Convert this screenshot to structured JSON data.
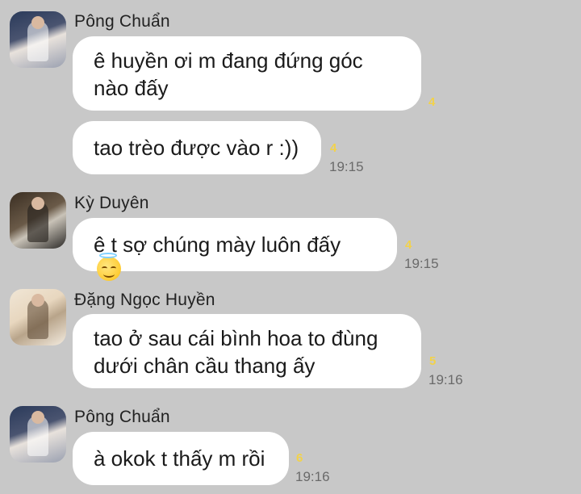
{
  "messages": [
    {
      "sender": "Pông Chuẩn",
      "avatar": "avatar-pong-chuan",
      "bubbles": [
        {
          "lines": [
            "ê huyền ơi m đang đứng góc",
            "nào đấy"
          ],
          "count": "4",
          "time": ""
        },
        {
          "lines": [
            "tao trèo được vào r :))"
          ],
          "count": "4",
          "time": "19:15"
        }
      ]
    },
    {
      "sender": "Kỳ Duyên",
      "avatar": "avatar-ky-duyen",
      "bubbles": [
        {
          "lines": [
            "ê t sợ chúng mày luôn đấy"
          ],
          "emoji": "smiling-face-with-halo-icon",
          "count": "4",
          "time": "19:15"
        }
      ]
    },
    {
      "sender": "Đặng Ngọc Huyền",
      "avatar": "avatar-dang-ngoc-huyen",
      "bubbles": [
        {
          "lines": [
            "tao ở sau cái bình hoa to đùng",
            "dưới chân cầu thang ấy"
          ],
          "count": "5",
          "time": "19:16"
        }
      ]
    },
    {
      "sender": "Pông Chuẩn",
      "avatar": "avatar-pong-chuan",
      "bubbles": [
        {
          "lines": [
            "à okok t thấy m rồi"
          ],
          "count": "6",
          "time": "19:16"
        }
      ]
    }
  ],
  "colors": {
    "background": "#c8c8c8",
    "bubble": "#ffffff",
    "read_count": "#f2d24a",
    "time": "#6a6a6a"
  }
}
